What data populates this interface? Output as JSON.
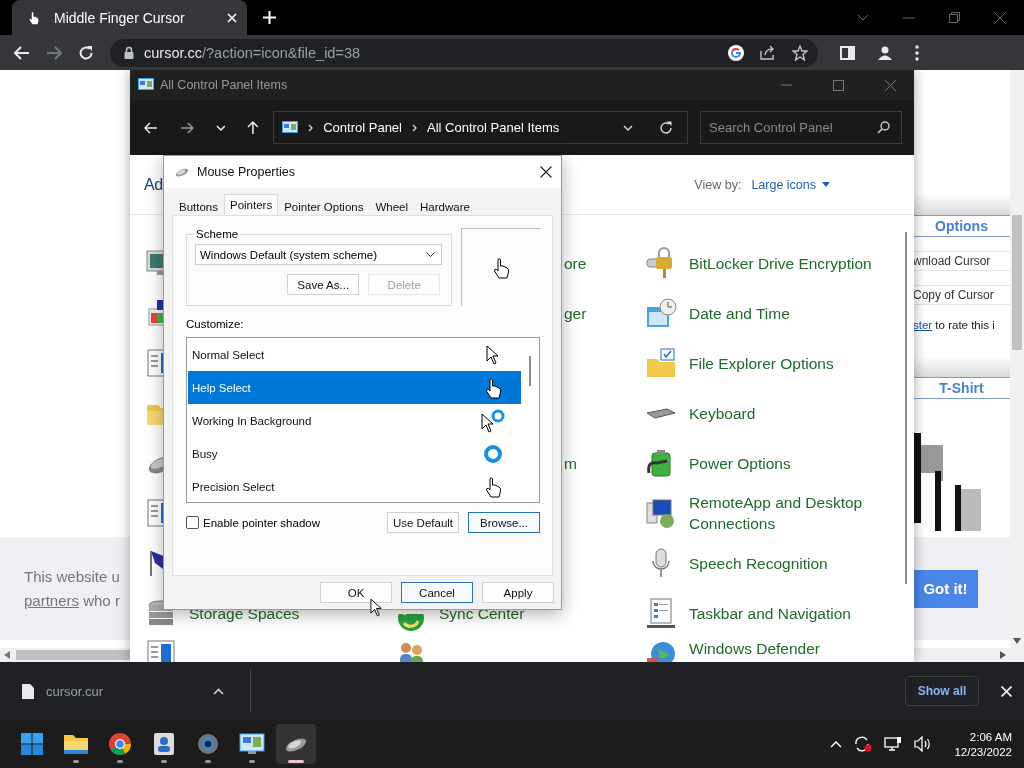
{
  "browser": {
    "tab": {
      "title": "Middle Finger Cursor"
    },
    "url_host": "cursor.cc",
    "url_path": "/?action=icon&file_id=38"
  },
  "web_page": {
    "sidebar": [
      {
        "kind": "heading",
        "text": "Options"
      },
      {
        "kind": "link",
        "text": "wnload Cursor"
      },
      {
        "kind": "link",
        "text": "Copy of Cursor"
      },
      {
        "kind": "note",
        "link": "ster",
        "text": " to rate this i"
      },
      {
        "kind": "heading",
        "text": "T-Shirt"
      }
    ],
    "cookie_lines": [
      {
        "text": "This website u"
      },
      {
        "link": "partners",
        "text": " who r"
      }
    ],
    "accept_button": "Got it!"
  },
  "control_panel": {
    "title": "All Control Panel Items",
    "breadcrumb": [
      "Control Panel",
      "All Control Panel Items"
    ],
    "search_placeholder": "Search Control Panel",
    "heading": "Ad",
    "view_by_label": "View by:",
    "view_by_value": "Large icons",
    "rows": [
      {
        "cells": [
          {
            "kind": "icon"
          },
          {
            "kind": "text",
            "label": "ore"
          },
          {
            "kind": "item",
            "label": "BitLocker Drive Encryption"
          }
        ]
      },
      {
        "cells": [
          {
            "kind": "icon"
          },
          {
            "kind": "text",
            "label": "ger"
          },
          {
            "kind": "item",
            "label": "Date and Time"
          }
        ]
      },
      {
        "cells": [
          {
            "kind": "icon"
          },
          {
            "kind": "blank"
          },
          {
            "kind": "item",
            "label": "File Explorer Options"
          }
        ]
      },
      {
        "cells": [
          {
            "kind": "icon"
          },
          {
            "kind": "blank"
          },
          {
            "kind": "item",
            "label": "Keyboard"
          }
        ]
      },
      {
        "cells": [
          {
            "kind": "icon"
          },
          {
            "kind": "text",
            "label": "m"
          },
          {
            "kind": "item",
            "label": "Power Options"
          }
        ]
      },
      {
        "cells": [
          {
            "kind": "icon"
          },
          {
            "kind": "blank"
          },
          {
            "kind": "item",
            "label": "RemoteApp and Desktop Connections"
          }
        ]
      },
      {
        "cells": [
          {
            "kind": "icon"
          },
          {
            "kind": "blank"
          },
          {
            "kind": "item",
            "label": "Speech Recognition"
          }
        ]
      },
      {
        "cells": [
          {
            "kind": "item",
            "label": "Storage Spaces"
          },
          {
            "kind": "item",
            "label": "Sync Center"
          },
          {
            "kind": "item",
            "label": "Taskbar and Navigation"
          }
        ]
      },
      {
        "cells": [
          {
            "kind": "icon"
          },
          {
            "kind": "icon"
          },
          {
            "kind": "item",
            "label": "Windows Defender"
          }
        ]
      }
    ]
  },
  "dialog": {
    "title": "Mouse Properties",
    "tabs": [
      {
        "label": "Buttons",
        "selected": false
      },
      {
        "label": "Pointers",
        "selected": true
      },
      {
        "label": "Pointer Options",
        "selected": false
      },
      {
        "label": "Wheel",
        "selected": false
      },
      {
        "label": "Hardware",
        "selected": false
      }
    ],
    "scheme_label": "Scheme",
    "scheme_value": "Windows Default (system scheme)",
    "scheme_buttons": [
      {
        "label": "Save As...",
        "disabled": false
      },
      {
        "label": "Delete",
        "disabled": true
      }
    ],
    "customize_label": "Customize:",
    "pointers": [
      {
        "label": "Normal Select",
        "selected": false
      },
      {
        "label": "Help Select",
        "selected": true
      },
      {
        "label": "Working In Background",
        "selected": false
      },
      {
        "label": "Busy",
        "selected": false
      },
      {
        "label": "Precision Select",
        "selected": false
      }
    ],
    "shadow": {
      "label": "Enable pointer shadow",
      "checked": false
    },
    "list_buttons": [
      {
        "label": "Use Default",
        "focused": false
      },
      {
        "label": "Browse...",
        "focused": true
      }
    ],
    "footer_buttons": [
      {
        "label": "OK",
        "focused": false
      },
      {
        "label": "Cancel",
        "focused": true
      },
      {
        "label": "Apply",
        "focused": false
      }
    ]
  },
  "download_bar": {
    "file": "cursor.cur",
    "show_all": "Show all"
  },
  "taskbar": {
    "apps": [
      {
        "active": false
      },
      {
        "active": false
      },
      {
        "active": false
      },
      {
        "active": false
      },
      {
        "active": false
      },
      {
        "active": true
      }
    ],
    "time": "2:06 AM",
    "date": "12/23/2022"
  }
}
